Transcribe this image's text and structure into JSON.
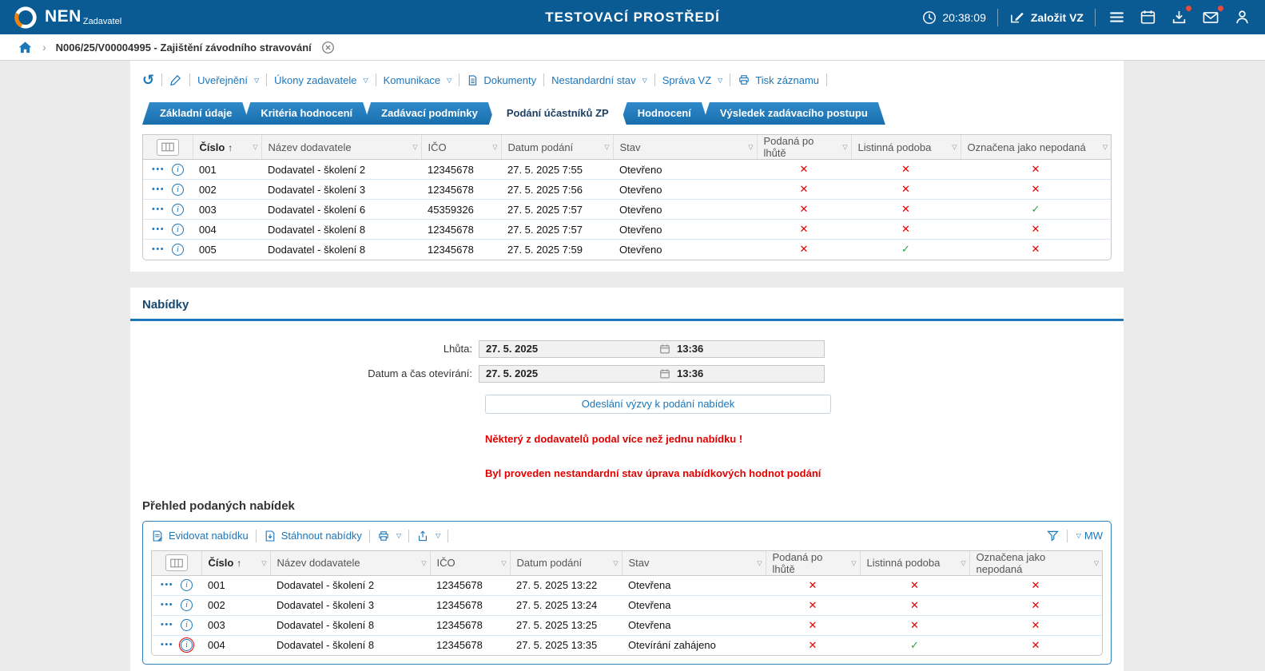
{
  "header": {
    "logo": "NEN",
    "logo_sub": "Zadavatel",
    "env_title": "TESTOVACÍ PROSTŘEDÍ",
    "time": "20:38:09",
    "create_vz": "Založit VZ"
  },
  "breadcrumb": {
    "record": "N006/25/V00004995 - Zajištění závodního stravování"
  },
  "command_bar": {
    "items": [
      {
        "label": "Uveřejnění"
      },
      {
        "label": "Úkony zadavatele"
      },
      {
        "label": "Komunikace"
      },
      {
        "label": "Dokumenty"
      },
      {
        "label": "Nestandardní stav"
      },
      {
        "label": "Správa VZ"
      },
      {
        "label": "Tisk záznamu"
      }
    ]
  },
  "tabs": [
    {
      "label": "Základní údaje",
      "active": false
    },
    {
      "label": "Kritéria hodnocení",
      "active": false
    },
    {
      "label": "Zadávací podmínky",
      "active": false
    },
    {
      "label": "Podání účastníků ZP",
      "active": true
    },
    {
      "label": "Hodnocení",
      "active": false
    },
    {
      "label": "Výsledek zadávacího postupu",
      "active": false
    }
  ],
  "columns": [
    "Číslo",
    "Název dodavatele",
    "IČO",
    "Datum podání",
    "Stav",
    "Podaná po lhůtě",
    "Listinná podoba",
    "Označena jako nepodaná"
  ],
  "participants_table": {
    "rows": [
      {
        "num": "001",
        "name": "Dodavatel - školení 2",
        "ico": "12345678",
        "date": "27. 5. 2025 7:55",
        "status": "Otevřeno",
        "late": "✕",
        "paper": "✕",
        "not_submitted": "✕"
      },
      {
        "num": "002",
        "name": "Dodavatel - školení 3",
        "ico": "12345678",
        "date": "27. 5. 2025 7:56",
        "status": "Otevřeno",
        "late": "✕",
        "paper": "✕",
        "not_submitted": "✕"
      },
      {
        "num": "003",
        "name": "Dodavatel - školení 6",
        "ico": "45359326",
        "date": "27. 5. 2025 7:57",
        "status": "Otevřeno",
        "late": "✕",
        "paper": "✕",
        "not_submitted": "✓"
      },
      {
        "num": "004",
        "name": "Dodavatel - školení 8",
        "ico": "12345678",
        "date": "27. 5. 2025 7:57",
        "status": "Otevřeno",
        "late": "✕",
        "paper": "✕",
        "not_submitted": "✕"
      },
      {
        "num": "005",
        "name": "Dodavatel - školení 8",
        "ico": "12345678",
        "date": "27. 5. 2025 7:59",
        "status": "Otevřeno",
        "late": "✕",
        "paper": "✓",
        "not_submitted": "✕"
      }
    ]
  },
  "offers": {
    "section_title": "Nabídky",
    "deadline_label": "Lhůta:",
    "deadline_date": "27. 5. 2025",
    "deadline_time": "13:36",
    "opening_label": "Datum a čas otevírání:",
    "opening_date": "27. 5. 2025",
    "opening_time": "13:36",
    "send_button": "Odeslání výzvy k podání nabídek",
    "warning_duplicate": "Některý z dodavatelů podal více než jednu nabídku !",
    "warning_nonstandard": "Byl proveden nestandardní stav úprava nabídkových hodnot podání",
    "overview_title": "Přehled podaných nabídek",
    "toolbar": {
      "register": "Evidovat nabídku",
      "download": "Stáhnout nabídky",
      "mw": "MW"
    }
  },
  "offers_table": {
    "rows": [
      {
        "num": "001",
        "name": "Dodavatel - školení 2",
        "ico": "12345678",
        "date": "27. 5. 2025 13:22",
        "status": "Otevřena",
        "late": "✕",
        "paper": "✕",
        "not_submitted": "✕"
      },
      {
        "num": "002",
        "name": "Dodavatel - školení 3",
        "ico": "12345678",
        "date": "27. 5. 2025 13:24",
        "status": "Otevřena",
        "late": "✕",
        "paper": "✕",
        "not_submitted": "✕"
      },
      {
        "num": "003",
        "name": "Dodavatel - školení 8",
        "ico": "12345678",
        "date": "27. 5. 2025 13:25",
        "status": "Otevřena",
        "late": "✕",
        "paper": "✕",
        "not_submitted": "✕"
      },
      {
        "num": "004",
        "name": "Dodavatel - školení 8",
        "ico": "12345678",
        "date": "27. 5. 2025 13:35",
        "status": "Otevírání zahájeno",
        "late": "✕",
        "paper": "✓",
        "not_submitted": "✕"
      }
    ]
  }
}
